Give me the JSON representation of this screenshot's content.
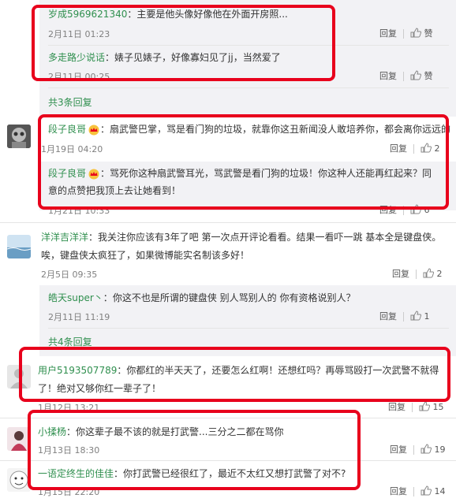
{
  "rows": [
    {
      "name": "岁成5969621340",
      "colon": "：",
      "text": "主要是他头像好像他在外面开房照...",
      "time": "2月11日 01:23",
      "reply": "回复",
      "like": "赞"
    },
    {
      "name": "多走路少说话",
      "colon": "：",
      "text": "婊子见婊子，好像寡妇见了jj，当然爱了",
      "time": "2月11日 00:25",
      "reply": "回复",
      "like": "赞"
    },
    {
      "more": "共3条回复"
    },
    {
      "name": "段子良哥",
      "colon": "：",
      "text": "扇武警巴掌，骂是看门狗的垃圾，就靠你这丑新闻没人敢培养你，都会离你远远的",
      "time": "1月19日 04:20",
      "reply": "回复",
      "like": "2"
    },
    {
      "name": "段子良哥",
      "colon": "：",
      "text1": "骂死你这种扇武警耳光，骂武警是看门狗的垃圾！你这种人还能再红起来？同",
      "text2": "意的点赞把我顶上去让她看到！",
      "time": "1月21日 10:33",
      "reply": "回复",
      "like": "6"
    },
    {
      "name": "洋洋吉洋洋",
      "colon": "：",
      "text1": "我关注你应该有3年了吧 第一次点开评论看看。结果一看吓一跳 基本全是键盘侠。",
      "text2": "唉，键盘侠太疯狂了，如果微博能实名制该多好！",
      "time": "2月5日 09:35",
      "reply": "回复",
      "like": "2"
    },
    {
      "name": "皓天super丶",
      "colon": "：",
      "text": "你这不也是所谓的键盘侠 别人骂别人的 你有资格说别人？",
      "time": "2月11日 11:19",
      "reply": "回复",
      "like": "1"
    },
    {
      "more": "共4条回复"
    },
    {
      "name": "用户5193507789",
      "colon": "：",
      "text1": "你都红的半天天了，还要怎么红啊！还想红吗？再辱骂殴打一次武警不就得",
      "text2": "了！绝对又够你红一辈子了！",
      "time": "1月12日 13:21",
      "reply": "回复",
      "like": "15"
    },
    {
      "name": "小揉杨",
      "colon": "：",
      "text": "你这辈子最不该的就是打武警...三分之二都在骂你",
      "time": "1月13日 18:30",
      "reply": "回复",
      "like": "19"
    },
    {
      "name": "一语定终生的佳佳",
      "colon": "：",
      "text": "你打武警已经很红了，最近不太红又想打武警了对不?",
      "time": "1月15日 22:20",
      "reply": "回复",
      "like": "14"
    }
  ],
  "colors": {
    "name": "#2f8f4e",
    "highlight": "#e8001c",
    "reply_bg": "#f2f2f5"
  },
  "icons": {
    "like": "thumbs-up-icon",
    "vip": "vip-crown-icon"
  }
}
